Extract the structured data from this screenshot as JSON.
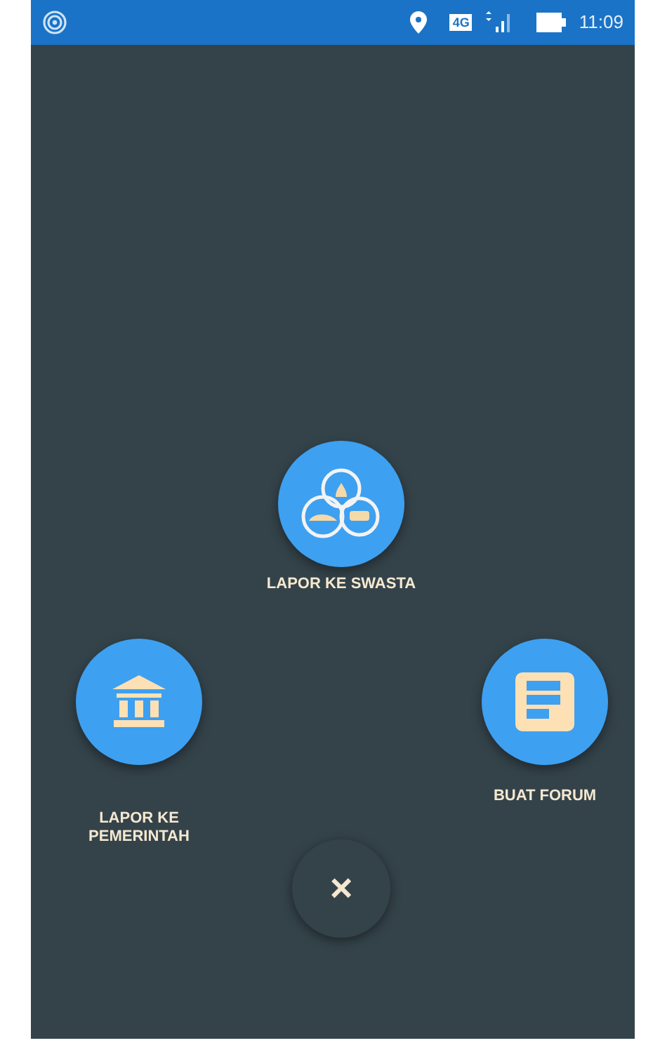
{
  "status_bar": {
    "time": "11:09",
    "network": "4G"
  },
  "actions": [
    {
      "kind": "private",
      "label": "LAPOR KE SWASTA"
    },
    {
      "kind": "government",
      "label": "LAPOR KE PEMERINTAH"
    },
    {
      "kind": "forum",
      "label": "BUAT FORUM"
    }
  ],
  "close_button": {
    "label": "×"
  }
}
